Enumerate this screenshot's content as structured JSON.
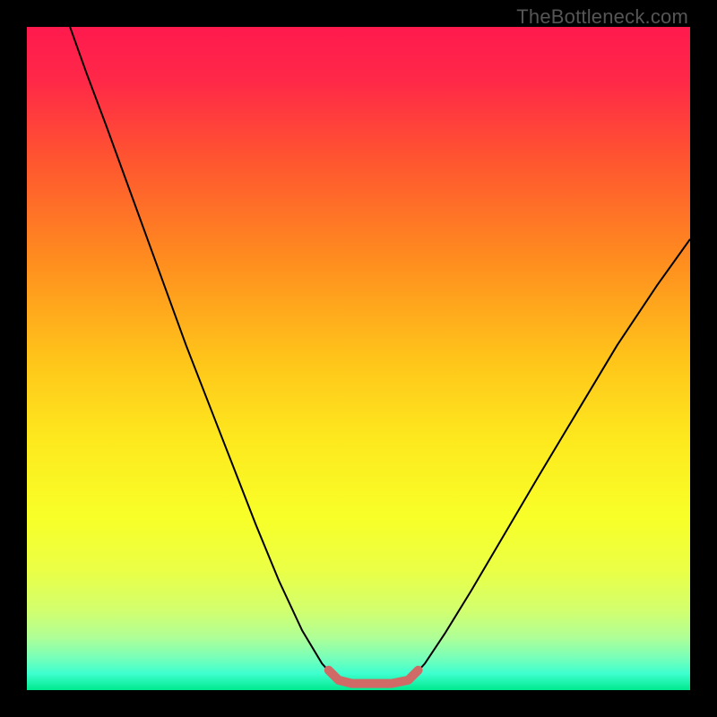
{
  "watermark": "TheBottleneck.com",
  "chart_data": {
    "type": "line",
    "title": "",
    "xlabel": "",
    "ylabel": "",
    "xlim": [
      0,
      1
    ],
    "ylim": [
      0,
      1
    ],
    "gradient_stops": [
      {
        "offset": 0.0,
        "color": "#ff1a4e"
      },
      {
        "offset": 0.08,
        "color": "#ff2848"
      },
      {
        "offset": 0.2,
        "color": "#ff5530"
      },
      {
        "offset": 0.35,
        "color": "#ff8c1f"
      },
      {
        "offset": 0.5,
        "color": "#ffc41a"
      },
      {
        "offset": 0.62,
        "color": "#fde81e"
      },
      {
        "offset": 0.74,
        "color": "#f8ff28"
      },
      {
        "offset": 0.82,
        "color": "#eaff46"
      },
      {
        "offset": 0.88,
        "color": "#d2ff6e"
      },
      {
        "offset": 0.92,
        "color": "#b0ff96"
      },
      {
        "offset": 0.95,
        "color": "#7affb8"
      },
      {
        "offset": 0.975,
        "color": "#3effcf"
      },
      {
        "offset": 1.0,
        "color": "#00e98e"
      }
    ],
    "series": [
      {
        "name": "bottleneck-curve",
        "color": "#000000",
        "stroke_width": 2,
        "points": [
          {
            "x": 0.065,
            "y": 1.0
          },
          {
            "x": 0.09,
            "y": 0.93
          },
          {
            "x": 0.12,
            "y": 0.85
          },
          {
            "x": 0.16,
            "y": 0.74
          },
          {
            "x": 0.2,
            "y": 0.63
          },
          {
            "x": 0.24,
            "y": 0.52
          },
          {
            "x": 0.275,
            "y": 0.43
          },
          {
            "x": 0.31,
            "y": 0.34
          },
          {
            "x": 0.345,
            "y": 0.25
          },
          {
            "x": 0.38,
            "y": 0.165
          },
          {
            "x": 0.415,
            "y": 0.09
          },
          {
            "x": 0.445,
            "y": 0.04
          },
          {
            "x": 0.465,
            "y": 0.018
          },
          {
            "x": 0.485,
            "y": 0.01
          },
          {
            "x": 0.52,
            "y": 0.01
          },
          {
            "x": 0.555,
            "y": 0.01
          },
          {
            "x": 0.58,
            "y": 0.018
          },
          {
            "x": 0.6,
            "y": 0.04
          },
          {
            "x": 0.63,
            "y": 0.085
          },
          {
            "x": 0.67,
            "y": 0.15
          },
          {
            "x": 0.72,
            "y": 0.235
          },
          {
            "x": 0.77,
            "y": 0.32
          },
          {
            "x": 0.83,
            "y": 0.42
          },
          {
            "x": 0.89,
            "y": 0.52
          },
          {
            "x": 0.95,
            "y": 0.61
          },
          {
            "x": 1.0,
            "y": 0.68
          }
        ]
      },
      {
        "name": "bottom-highlight",
        "color": "#d06a66",
        "stroke_width": 10,
        "points": [
          {
            "x": 0.455,
            "y": 0.03
          },
          {
            "x": 0.47,
            "y": 0.015
          },
          {
            "x": 0.49,
            "y": 0.01
          },
          {
            "x": 0.52,
            "y": 0.01
          },
          {
            "x": 0.55,
            "y": 0.01
          },
          {
            "x": 0.575,
            "y": 0.015
          },
          {
            "x": 0.59,
            "y": 0.03
          }
        ]
      }
    ]
  }
}
